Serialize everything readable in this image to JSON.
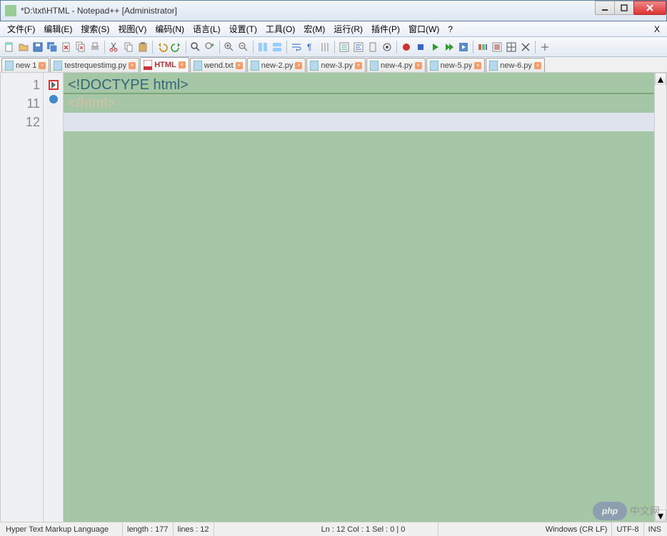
{
  "window": {
    "title": "*D:\\txt\\HTML - Notepad++ [Administrator]",
    "close_x": "X"
  },
  "menu": {
    "items": [
      "文件(F)",
      "编辑(E)",
      "搜索(S)",
      "视图(V)",
      "编码(N)",
      "语言(L)",
      "设置(T)",
      "工具(O)",
      "宏(M)",
      "运行(R)",
      "插件(P)",
      "窗口(W)",
      "?"
    ],
    "right": "X"
  },
  "tabs": {
    "items": [
      {
        "label": "new 1",
        "icon": "py",
        "active": false
      },
      {
        "label": "testrequestimg.py",
        "icon": "py",
        "active": false
      },
      {
        "label": "HTML",
        "icon": "html",
        "active": true
      },
      {
        "label": "wend.txt",
        "icon": "txt",
        "active": false
      },
      {
        "label": "new-2.py",
        "icon": "py",
        "active": false
      },
      {
        "label": "new-3.py",
        "icon": "py",
        "active": false
      },
      {
        "label": "new-4.py",
        "icon": "py",
        "active": false
      },
      {
        "label": "new-5.py",
        "icon": "py",
        "active": false
      },
      {
        "label": "new-6.py",
        "icon": "py",
        "active": false
      }
    ]
  },
  "editor": {
    "line_numbers": [
      "1",
      "11",
      "12"
    ],
    "lines": {
      "0": "<!DOCTYPE html>",
      "1": "</html>",
      "2": ""
    }
  },
  "status": {
    "lang": "Hyper Text Markup Language",
    "length": "length : 177",
    "lines": "lines : 12",
    "pos": "Ln : 12    Col : 1    Sel : 0 | 0",
    "eol": "Windows (CR LF)",
    "enc": "UTF-8",
    "mode": "INS"
  },
  "watermark": {
    "logo": "php",
    "text": "中文网"
  }
}
